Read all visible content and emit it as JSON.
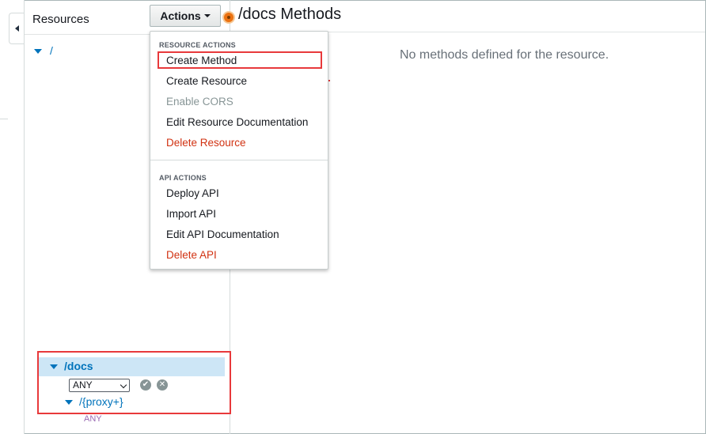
{
  "resources_panel": {
    "title": "Resources",
    "root_path": "/",
    "selected_resource": "/docs",
    "method_select_value": "ANY",
    "child_resource": "/{proxy+}",
    "child_method": "ANY"
  },
  "actions": {
    "button_label": "Actions",
    "sections": [
      {
        "header": "RESOURCE ACTIONS",
        "items": [
          {
            "label": "Create Method",
            "state": "highlighted"
          },
          {
            "label": "Create Resource",
            "state": "normal"
          },
          {
            "label": "Enable CORS",
            "state": "disabled"
          },
          {
            "label": "Edit Resource Documentation",
            "state": "normal"
          },
          {
            "label": "Delete Resource",
            "state": "danger"
          }
        ]
      },
      {
        "header": "API ACTIONS",
        "items": [
          {
            "label": "Deploy API",
            "state": "normal"
          },
          {
            "label": "Import API",
            "state": "normal"
          },
          {
            "label": "Edit API Documentation",
            "state": "normal"
          },
          {
            "label": "Delete API",
            "state": "danger"
          }
        ]
      }
    ]
  },
  "main": {
    "title": "/docs Methods",
    "empty_message": "No methods defined for the resource."
  },
  "colors": {
    "link": "#0073bb",
    "danger": "#d13212",
    "highlight_border": "#e8393b",
    "selected_row": "#cde6f6",
    "status_dot": "#ec7211"
  },
  "icons": {
    "collapse": "triangle-left",
    "tree_expand": "triangle-down",
    "confirm": "check-circle",
    "cancel": "x-circle",
    "status": "orange-dot"
  }
}
